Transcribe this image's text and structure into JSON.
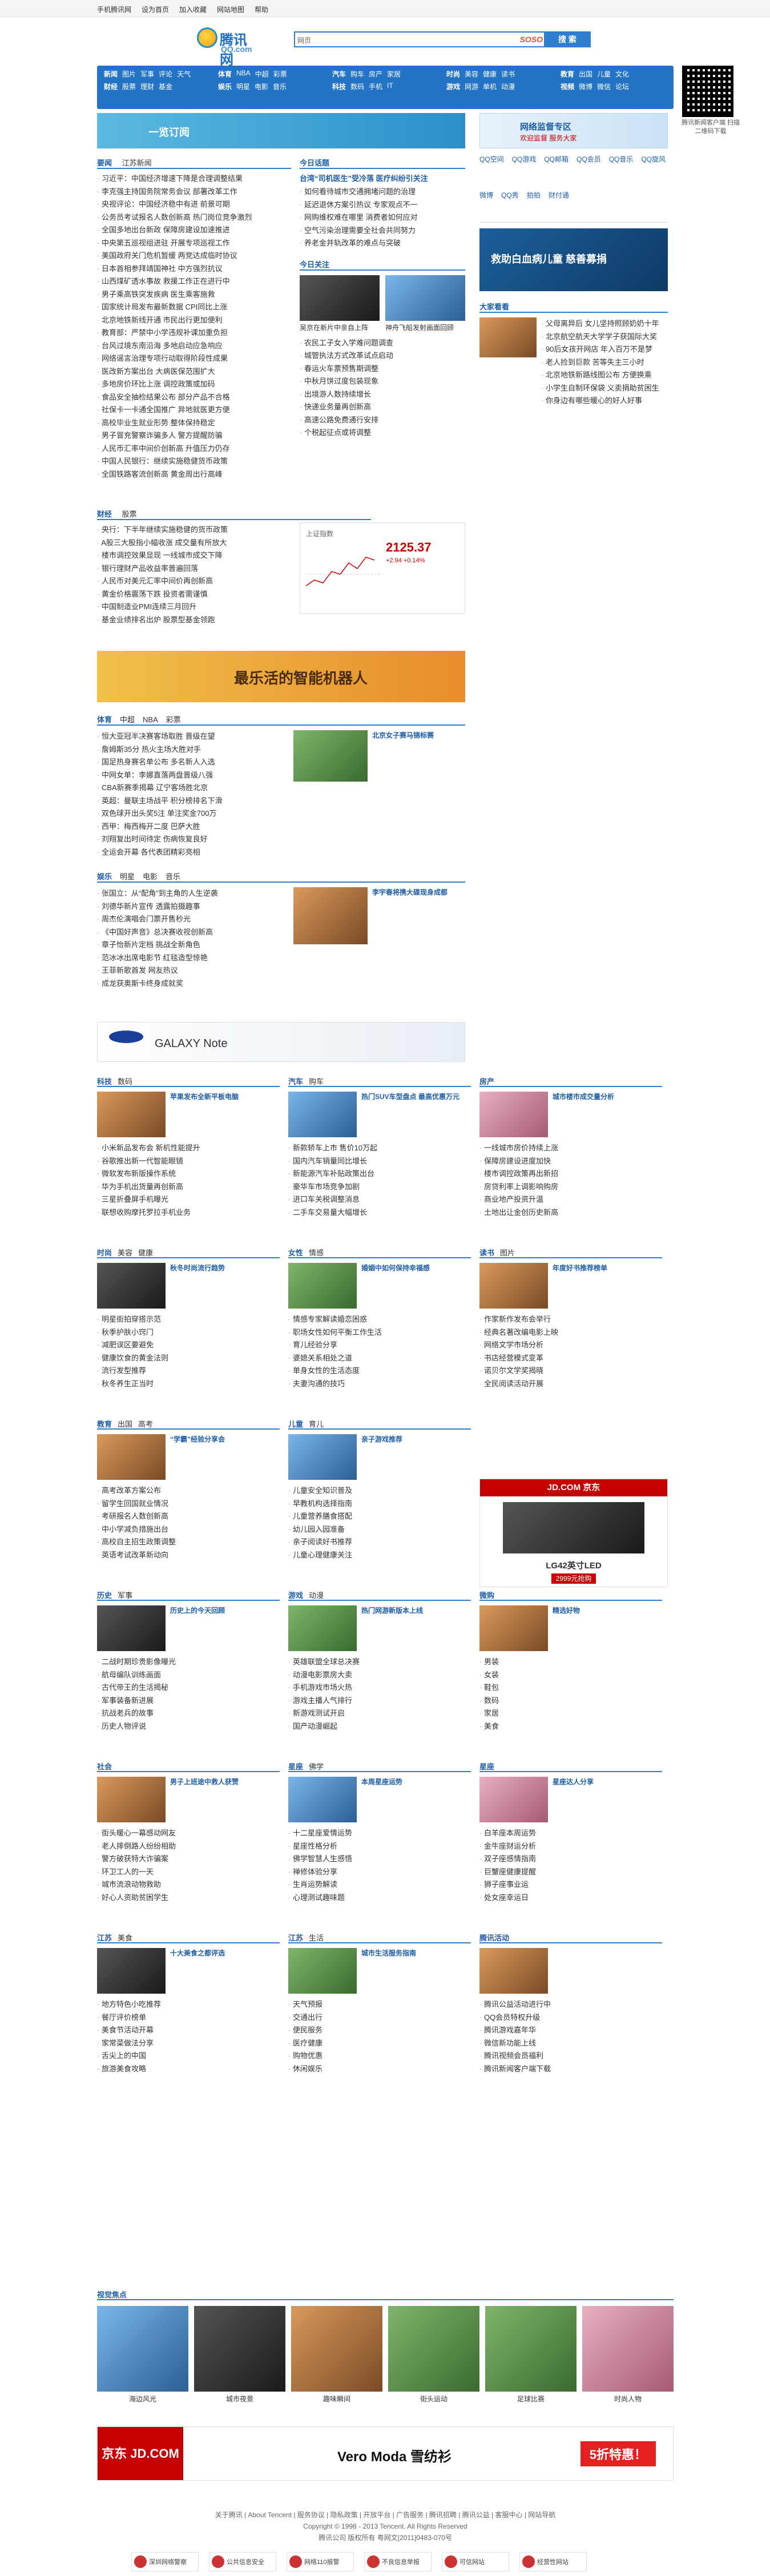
{
  "topbar": [
    "手机腾讯网",
    "设为首页",
    "加入收藏",
    "网站地图",
    "帮助"
  ],
  "logo": {
    "main": "腾讯网",
    "sub": "QQ.com"
  },
  "search": {
    "category": "网页",
    "engine": "SOSO",
    "button": "搜 索"
  },
  "nav": [
    [
      "新闻",
      "图片",
      "军事",
      "评论",
      "天气"
    ],
    [
      "财经",
      "股票",
      "理财",
      "基金"
    ],
    [
      "体育",
      "NBA",
      "中超",
      "彩票"
    ],
    [
      "娱乐",
      "明星",
      "电影",
      "音乐"
    ],
    [
      "汽车",
      "购车",
      "房产",
      "家居"
    ],
    [
      "科技",
      "数码",
      "手机",
      "IT"
    ],
    [
      "时尚",
      "美容",
      "健康",
      "读书"
    ],
    [
      "游戏",
      "网游",
      "单机",
      "动漫"
    ],
    [
      "教育",
      "出国",
      "儿童",
      "文化"
    ],
    [
      "视频",
      "微博",
      "微信",
      "论坛"
    ]
  ],
  "qr_caption": "腾讯新闻客户端 扫描二维码下载",
  "banner_top": {
    "left": "一览订阅",
    "right": "网络监督专区",
    "right_sub": "欢迎监督 服务大家"
  },
  "news": {
    "tabs": [
      "要闻",
      "江苏新闻"
    ],
    "items": [
      "习近平：中国经济增速下降是合理调整结果",
      "李克强主持国务院常务会议 部署改革工作",
      "央视评论：中国经济稳中有进 前景可期",
      "公务员考试报名人数创新高 热门岗位竞争激烈",
      "全国多地出台新政 保障房建设加速推进",
      "中央第五巡视组进驻 开展专项巡视工作",
      "美国政府关门危机暂缓 两党达成临时协议",
      "日本首相参拜靖国神社 中方强烈抗议",
      "山西煤矿透水事故 救援工作正在进行中",
      "男子乘高铁突发疾病 医生乘客施救",
      "国家统计局发布最新数据 CPI同比上涨",
      "北京地铁新线开通 市民出行更加便利",
      "教育部：严禁中小学违规补课加重负担",
      "台风过境东南沿海 多地启动应急响应",
      "网络谣言治理专项行动取得阶段性成果",
      "医改新方案出台 大病医保范围扩大",
      "多地房价环比上涨 调控政策或加码",
      "食品安全抽检结果公布 部分产品不合格",
      "社保卡一卡通全国推广 异地就医更方便",
      "高校毕业生就业形势 整体保持稳定",
      "男子冒充警察诈骗多人 警方提醒防骗",
      "人民币汇率中间价创新高 升值压力仍存",
      "中国人民银行：继续实施稳健货币政策",
      "全国铁路客流创新高 黄金周出行高峰"
    ]
  },
  "today": {
    "title": "今日话题",
    "lead": "台湾“司机医生”受冷落 医疗纠纷引关注",
    "items": [
      "如何看待城市交通拥堵问题的治理",
      "延迟退休方案引热议 专家观点不一",
      "网购维权难在哪里 消费者如何应对",
      "空气污染治理需要全社会共同努力",
      "养老金并轨改革的难点与突破"
    ],
    "video_title": "今日关注",
    "videos": [
      "吴京在新片中亲自上阵",
      "神舟飞船发射画面回顾"
    ],
    "more": [
      "农民工子女入学难问题调查",
      "城管执法方式改革试点启动",
      "春运火车票预售期调整",
      "中秋月饼过度包装现象",
      "出境游人数持续增长",
      "快递业务量再创新高",
      "高速公路免费通行安排",
      "个税起征点或将调整"
    ]
  },
  "right_col": {
    "services": [
      "QQ空间",
      "QQ游戏",
      "QQ邮箱",
      "QQ会员",
      "QQ音乐",
      "QQ旋风",
      "微博",
      "QQ秀",
      "拍拍",
      "财付通"
    ],
    "charity": "救助白血病儿童 慈善募捐",
    "ad_title": "大家看看",
    "items": [
      "父母离异后 女儿坚持照顾奶奶十年",
      "北京航空航天大学学子获国际大奖",
      "90后女孩开网店 年入百万不是梦",
      "老人捡到巨款 苦等失主三小时",
      "北京地铁新路线图公布 方便换乘",
      "小学生自制环保袋 义卖捐助贫困生",
      "你身边有哪些暖心的好人好事"
    ]
  },
  "finance": {
    "tabs": [
      "财经",
      "股票"
    ],
    "index_label": "上证指数",
    "index_value": "2125.37",
    "index_change": "+2.94",
    "index_pct": "+0.14%",
    "items": [
      "央行：下半年继续实施稳健的货币政策",
      "A股三大股指小幅收涨 成交量有所放大",
      "楼市调控效果显现 一线城市成交下降",
      "银行理财产品收益率普遍回落",
      "人民币对美元汇率中间价再创新高",
      "黄金价格震荡下跌 投资者需谨慎",
      "中国制造业PMI连续三月回升",
      "基金业绩排名出炉 股票型基金领跑"
    ]
  },
  "robot_banner": "最乐活的智能机器人",
  "sports": {
    "tabs": [
      "体育",
      "中超",
      "NBA",
      "彩票"
    ],
    "lead": "北京女子赛马锦标赛",
    "items": [
      "恒大亚冠半决赛客场取胜 晋级在望",
      "詹姆斯35分 热火主场大胜对手",
      "国足热身赛名单公布 多名新人入选",
      "中网女单：李娜直落两盘晋级八强",
      "CBA新赛季揭幕 辽宁客场胜北京",
      "英超：曼联主场战平 积分榜排名下滑",
      "双色球开出头奖5注 单注奖金700万",
      "西甲：梅西梅开二度 巴萨大胜",
      "刘翔复出时间待定 伤病恢复良好",
      "全运会开幕 各代表团精彩亮相"
    ]
  },
  "ent": {
    "tabs": [
      "娱乐",
      "明星",
      "电影",
      "音乐"
    ],
    "lead": "李宇春将携大碟现身成都",
    "items": [
      "张国立：从“配角”到主角的人生逆袭",
      "刘德华新片宣传 透露拍摄趣事",
      "周杰伦演唱会门票开售秒光",
      "《中国好声音》总决赛收视创新高",
      "章子怡新片定档 挑战全新角色",
      "范冰冰出席电影节 红毯造型惊艳",
      "王菲新歌首发 网友热议",
      "成龙获奥斯卡终身成就奖"
    ]
  },
  "samsung_banner": "GALAXY Note",
  "section_blocks": [
    {
      "tabs": [
        "科技",
        "数码"
      ],
      "lead": "苹果发布全新平板电脑",
      "items": [
        "小米新品发布会 新机性能提升",
        "谷歌推出新一代智能眼镜",
        "微软发布新版操作系统",
        "华为手机出货量再创新高",
        "三星折叠屏手机曝光",
        "联想收购摩托罗拉手机业务"
      ]
    },
    {
      "tabs": [
        "汽车",
        "购车"
      ],
      "lead": "热门SUV车型盘点 最高优惠万元",
      "items": [
        "新款轿车上市 售价10万起",
        "国内汽车销量同比增长",
        "新能源汽车补贴政策出台",
        "豪华车市场竞争加剧",
        "进口车关税调整消息",
        "二手车交易量大幅增长"
      ]
    },
    {
      "tabs": [
        "房产"
      ],
      "lead": "城市楼市成交量分析",
      "items": [
        "一线城市房价持续上涨",
        "保障房建设进度加快",
        "楼市调控政策再出新招",
        "房贷利率上调影响购房",
        "商业地产投资升温",
        "土地出让金创历史新高"
      ]
    },
    {
      "tabs": [
        "时尚",
        "美容",
        "健康"
      ],
      "lead": "秋冬时尚流行趋势",
      "items": [
        "明星街拍穿搭示范",
        "秋季护肤小窍门",
        "减肥误区要避免",
        "健康饮食的黄金法则",
        "流行发型推荐",
        "秋冬养生正当时"
      ]
    },
    {
      "tabs": [
        "女性",
        "情感"
      ],
      "lead": "婚姻中如何保持幸福感",
      "items": [
        "情感专家解读婚恋困惑",
        "职场女性如何平衡工作生活",
        "育儿经验分享",
        "婆媳关系相处之道",
        "单身女性的生活态度",
        "夫妻沟通的技巧"
      ]
    },
    {
      "tabs": [
        "读书",
        "图片"
      ],
      "lead": "年度好书推荐榜单",
      "items": [
        "作家新作发布会举行",
        "经典名著改编电影上映",
        "网络文学市场分析",
        "书店经营模式变革",
        "诺贝尔文学奖揭晓",
        "全民阅读活动开展"
      ]
    },
    {
      "tabs": [
        "教育",
        "出国",
        "高考"
      ],
      "lead": "“学霸”经验分享会",
      "items": [
        "高考改革方案公布",
        "留学生回国就业情况",
        "考研报名人数创新高",
        "中小学减负措施出台",
        "高校自主招生政策调整",
        "英语考试改革新动向"
      ]
    },
    {
      "tabs": [
        "儿童",
        "育儿"
      ],
      "lead": "亲子游戏推荐",
      "items": [
        "儿童安全知识普及",
        "早教机构选择指南",
        "儿童营养膳食搭配",
        "幼儿园入园准备",
        "亲子阅读好书推荐",
        "儿童心理健康关注"
      ]
    },
    {
      "tabs": [
        "文化"
      ],
      "lead": "传统文化展览开幕",
      "items": [
        "非遗传承人展示技艺",
        "博物馆新展精彩纷呈",
        "传统节日文化习俗",
        "书画名家作品拍卖",
        "民俗文化活动丰富",
        "戏曲进校园活动"
      ]
    },
    {
      "tabs": [
        "历史",
        "军事"
      ],
      "lead": "历史上的今天回顾",
      "items": [
        "二战时期珍贵影像曝光",
        "航母编队训练画面",
        "古代帝王的生活揭秘",
        "军事装备新进展",
        "抗战老兵的故事",
        "历史人物评说"
      ]
    },
    {
      "tabs": [
        "游戏",
        "动漫"
      ],
      "lead": "热门网游新版本上线",
      "items": [
        "英雄联盟全球总决赛",
        "动漫电影票房大卖",
        "手机游戏市场火热",
        "游戏主播人气排行",
        "新游戏测试开启",
        "国产动漫崛起"
      ]
    },
    {
      "tabs": [
        "微购"
      ],
      "lead": "精选好物",
      "items": [
        "男装",
        "女装",
        "鞋包",
        "数码",
        "家居",
        "美食"
      ]
    },
    {
      "tabs": [
        "社会"
      ],
      "lead": "男子上班途中救人获赞",
      "items": [
        "街头暖心一幕感动网友",
        "老人摔倒路人纷纷相助",
        "警方破获特大诈骗案",
        "环卫工人的一天",
        "城市流浪动物救助",
        "好心人资助贫困学生"
      ]
    },
    {
      "tabs": [
        "星座",
        "佛学"
      ],
      "lead": "本周星座运势",
      "items": [
        "十二星座爱情运势",
        "星座性格分析",
        "佛学智慧人生感悟",
        "禅修体验分享",
        "生肖运势解读",
        "心理测试趣味题"
      ]
    },
    {
      "tabs": [
        "星座"
      ],
      "lead": "星座达人分享",
      "items": [
        "白羊座本周运势",
        "金牛座财运分析",
        "双子座感情指南",
        "巨蟹座健康提醒",
        "狮子座事业运",
        "处女座幸运日"
      ]
    },
    {
      "tabs": [
        "江苏",
        "美食"
      ],
      "lead": "十大美食之都评选",
      "items": [
        "地方特色小吃推荐",
        "餐厅评价榜单",
        "美食节活动开幕",
        "家常菜做法分享",
        "舌尖上的中国",
        "旅游美食攻略"
      ]
    },
    {
      "tabs": [
        "江苏",
        "生活"
      ],
      "lead": "城市生活服务指南",
      "items": [
        "天气预报",
        "交通出行",
        "便民服务",
        "医疗健康",
        "购物优惠",
        "休闲娱乐"
      ]
    },
    {
      "tabs": [
        "腾讯活动"
      ],
      "lead": "",
      "items": [
        "腾讯公益活动进行中",
        "QQ会员特权升级",
        "腾讯游戏嘉年华",
        "微信新功能上线",
        "腾讯视频会员福利",
        "腾讯新闻客户端下载"
      ]
    }
  ],
  "jd_ad": {
    "brand": "JD.COM 京东",
    "product": "LG42英寸LED",
    "price": "2999元抢购"
  },
  "video_strip": {
    "title": "视觉焦点",
    "items": [
      "海边风光",
      "城市夜景",
      "趣味瞬间",
      "街头运动",
      "足球比赛",
      "时尚人物"
    ]
  },
  "bottom_ad": {
    "left": "京东 JD.COM",
    "middle": "Vero Moda 雪纺衫",
    "right": "5折特惠！"
  },
  "footer": {
    "links": "关于腾讯 | About Tencent | 服务协议 | 隐私政策 | 开放平台 | 广告服务 | 腾讯招聘 | 腾讯公益 | 客服中心 | 网站导航",
    "copyright": "Copyright © 1998 - 2013 Tencent. All Rights Reserved",
    "license": "腾讯公司 版权所有 粤网文[2011]0483-070号"
  },
  "badges": [
    "深圳网络警察",
    "公共信息安全",
    "网络110报警",
    "不良信息举报",
    "可信网站",
    "经营性网站"
  ]
}
